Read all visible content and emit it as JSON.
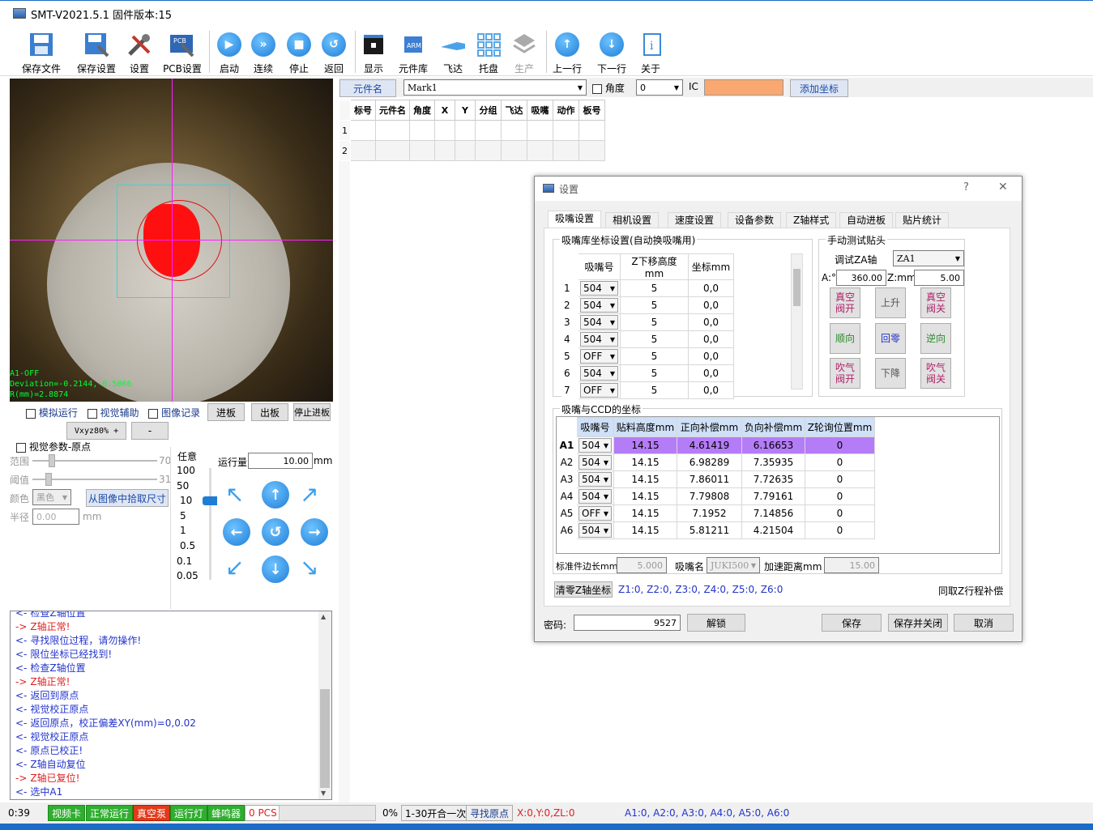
{
  "app": {
    "title": "SMT-V2021.5.1 固件版本:15"
  },
  "toolbar": {
    "items": [
      "保存文件",
      "保存设置",
      "设置",
      "PCB设置",
      "启动",
      "连续",
      "停止",
      "返回",
      "显示",
      "元件库",
      "飞达",
      "托盘",
      "生产",
      "上一行",
      "下一行",
      "关于"
    ]
  },
  "camera": {
    "overlay_lines": [
      "A1-OFF",
      "Deviation=-0.2144,-0.5066",
      "R(mm)=2.8874"
    ]
  },
  "options": {
    "sim_run": "模拟运行",
    "vision_assist": "视觉辅助",
    "image_record": "图像记录",
    "feed_in": "进板",
    "feed_out": "出板",
    "stop_feed": "停止进板",
    "speed_label": "Vxyz80% +",
    "minus": "-"
  },
  "vision": {
    "origin_label": "视觉参数-原点",
    "range_label": "范围",
    "range_value": "70",
    "threshold_label": "阈值",
    "threshold_value": "31",
    "color_label": "颜色",
    "color_value": "黑色",
    "pick_size_button": "从图像中拾取尺寸",
    "radius_label": "半径",
    "radius_value": "0.00",
    "radius_unit": "mm"
  },
  "jog": {
    "step_title": "任意",
    "steps": [
      "100",
      "50",
      "10",
      "5",
      "1",
      "0.5",
      "0.1",
      "0.05"
    ],
    "run_label": "运行量",
    "run_value": "10.00",
    "run_unit": "mm"
  },
  "log": [
    {
      "dir": "<-",
      "text": "检查Z轴位置",
      "color": "blue"
    },
    {
      "dir": "->",
      "text": "Z轴正常!",
      "color": "red"
    },
    {
      "dir": "<-",
      "text": "寻找限位过程，请勿操作!",
      "color": "blue"
    },
    {
      "dir": "<-",
      "text": "限位坐标已经找到!",
      "color": "blue"
    },
    {
      "dir": "<-",
      "text": "检查Z轴位置",
      "color": "blue"
    },
    {
      "dir": "->",
      "text": "Z轴正常!",
      "color": "red"
    },
    {
      "dir": "<-",
      "text": "返回到原点",
      "color": "blue"
    },
    {
      "dir": "<-",
      "text": "视觉校正原点",
      "color": "blue"
    },
    {
      "dir": "<-",
      "text": "返回原点，校正偏差XY(mm)=0,0.02",
      "color": "blue"
    },
    {
      "dir": "<-",
      "text": "视觉校正原点",
      "color": "blue"
    },
    {
      "dir": "<-",
      "text": "原点已校正!",
      "color": "blue"
    },
    {
      "dir": "<-",
      "text": "Z轴自动复位",
      "color": "blue"
    },
    {
      "dir": "->",
      "text": "Z轴已复位!",
      "color": "red"
    },
    {
      "dir": "<-",
      "text": "选中A1",
      "color": "blue"
    }
  ],
  "topbar": {
    "component_name_btn": "元件名",
    "mark_value": "Mark1",
    "angle_label": "角度",
    "angle_value": "0",
    "ic_label": "IC",
    "add_coord_btn": "添加坐标"
  },
  "main_grid": {
    "headers": [
      "标号",
      "元件名",
      "角度",
      "X",
      "Y",
      "分组",
      "飞达",
      "吸嘴",
      "动作",
      "板号"
    ],
    "rows": [
      "1",
      "2"
    ]
  },
  "dialog": {
    "title": "设置",
    "help": "?",
    "close": "✕",
    "tabs": [
      "吸嘴设置",
      "相机设置",
      "速度设置",
      "设备参数",
      "Z轴样式",
      "自动进板",
      "贴片统计"
    ],
    "nozzle_lib_title": "吸嘴库坐标设置(自动换吸嘴用)",
    "nozzle_lib_headers": [
      "吸嘴号",
      "Z下移高度mm",
      "坐标mm"
    ],
    "nozzle_lib_rows": [
      {
        "idx": "1",
        "nozzle": "504",
        "z": "5",
        "coord": "0,0"
      },
      {
        "idx": "2",
        "nozzle": "504",
        "z": "5",
        "coord": "0,0"
      },
      {
        "idx": "3",
        "nozzle": "504",
        "z": "5",
        "coord": "0,0"
      },
      {
        "idx": "4",
        "nozzle": "504",
        "z": "5",
        "coord": "0,0"
      },
      {
        "idx": "5",
        "nozzle": "OFF",
        "z": "5",
        "coord": "0,0"
      },
      {
        "idx": "6",
        "nozzle": "504",
        "z": "5",
        "coord": "0,0"
      },
      {
        "idx": "7",
        "nozzle": "OFF",
        "z": "5",
        "coord": "0,0"
      }
    ],
    "manual_title": "手动测试贴头",
    "debug_za_label": "调试ZA轴",
    "za_select": "ZA1",
    "a_label": "A:°",
    "a_value": "360.00",
    "z_label": "Z:mm",
    "z_value": "5.00",
    "manual_buttons": [
      "真空阀开",
      "上升",
      "真空阀关",
      "顺向",
      "回零",
      "逆向",
      "吹气阀开",
      "下降",
      "吹气阀关"
    ],
    "ccd_title": "吸嘴与CCD的坐标",
    "ccd_headers": [
      "吸嘴号",
      "贴料高度mm",
      "正向补偿mm",
      "负向补偿mm",
      "Z轮询位置mm"
    ],
    "ccd_rows": [
      {
        "id": "A1",
        "nozzle": "504",
        "h": "14.15",
        "pos": "4.61419",
        "neg": "6.16653",
        "z": "0"
      },
      {
        "id": "A2",
        "nozzle": "504",
        "h": "14.15",
        "pos": "6.98289",
        "neg": "7.35935",
        "z": "0"
      },
      {
        "id": "A3",
        "nozzle": "504",
        "h": "14.15",
        "pos": "7.86011",
        "neg": "7.72635",
        "z": "0"
      },
      {
        "id": "A4",
        "nozzle": "504",
        "h": "14.15",
        "pos": "7.79808",
        "neg": "7.79161",
        "z": "0"
      },
      {
        "id": "A5",
        "nozzle": "OFF",
        "h": "14.15",
        "pos": "7.1952",
        "neg": "7.14856",
        "z": "0"
      },
      {
        "id": "A6",
        "nozzle": "504",
        "h": "14.15",
        "pos": "5.81211",
        "neg": "4.21504",
        "z": "0"
      }
    ],
    "std_side_label": "标准件边长mm",
    "std_side_value": "5.000",
    "nozzle_name_label": "吸嘴名",
    "nozzle_name_value": "JUKI500",
    "accel_label": "加速距离mm",
    "accel_value": "15.00",
    "clear_z_btn": "清零Z轴坐标",
    "z_coords": "Z1:0, Z2:0, Z3:0, Z4:0, Z5:0, Z6:0",
    "same_z_label": "同取Z行程补偿",
    "password_label": "密码:",
    "password_value": "9527",
    "unlock_btn": "解锁",
    "save_btn": "保存",
    "save_close_btn": "保存并关闭",
    "cancel_btn": "取消"
  },
  "status": {
    "time": "0:39",
    "video_card": "视频卡",
    "normal_run": "正常运行",
    "vacuum_pump": "真空泵",
    "run_light": "运行灯",
    "buzzer": "蜂鸣器",
    "pcs": "0 PCS",
    "percent": "0%",
    "open_once": "1-30开合一次",
    "find_origin": "寻找原点",
    "xyz": "X:0,Y:0,ZL:0",
    "a_coords": "A1:0,  A2:0,  A3:0,  A4:0,  A5:0,  A6:0"
  },
  "colors": {
    "highlight_row": "#b57cf7",
    "accent": "#1c6bc7",
    "ic_field": "#f9a86f"
  }
}
